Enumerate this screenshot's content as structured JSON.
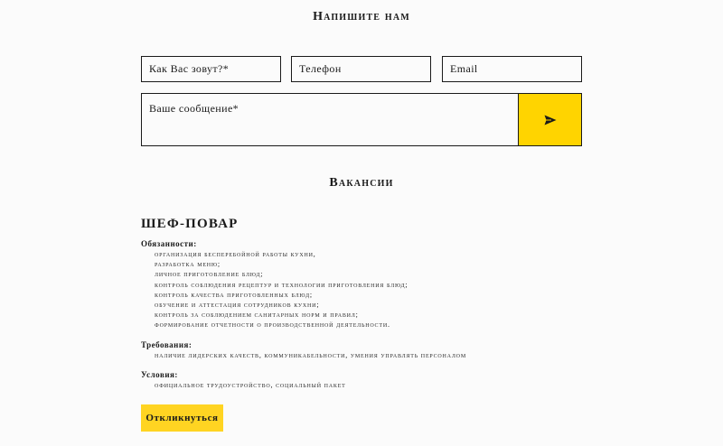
{
  "contact": {
    "title": "Напишите нам",
    "name_placeholder": "Как Вас зовут?*",
    "phone_placeholder": "Телефон",
    "email_placeholder": "Email",
    "message_placeholder": "Ваше сообщение*",
    "send_icon": "send-icon"
  },
  "vacancies": {
    "title": "Вакансии",
    "job_title": "ШЕФ-ПОВАР",
    "duties_title": "Обязанности:",
    "duties": [
      "организация бесперебойной работы кухни,",
      "разработка меню;",
      "личное приготовление блюд;",
      "контроль соблюдения рецептур и технологии приготовления блюд;",
      "контроль качества приготовленных блюд;",
      "обучение и аттестация сотрудников кухни;",
      "контроль за соблюдением санитарных норм и правил;",
      "формирование отчетности о производственной деятельности."
    ],
    "requirements_title": "Требования:",
    "requirements": [
      "наличие лидерских качеств, коммуникабельности, умения управлять персоналом"
    ],
    "conditions_title": "Условия:",
    "conditions": [
      "официальное трудоустройство, социальный пакет"
    ],
    "apply_label": "Откликнуться"
  },
  "colors": {
    "accent": "#ffd400",
    "text": "#1a1a1a",
    "background": "#fbfbfb"
  }
}
